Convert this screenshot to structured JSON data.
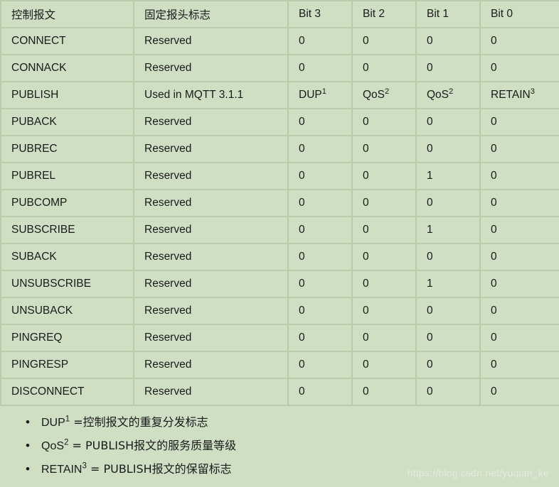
{
  "table": {
    "headers": [
      {
        "label": "控制报文",
        "type": "cn"
      },
      {
        "label": "固定报头标志",
        "type": "cn"
      },
      {
        "label": "Bit 3",
        "type": "bit"
      },
      {
        "label": "Bit 2",
        "type": "bit"
      },
      {
        "label": "Bit 1",
        "type": "bit"
      },
      {
        "label": "Bit 0",
        "type": "bit"
      }
    ],
    "rows": [
      {
        "message": "CONNECT",
        "flags": "Reserved",
        "bit3": "0",
        "bit2": "0",
        "bit1": "0",
        "bit0": "0"
      },
      {
        "message": "CONNACK",
        "flags": "Reserved",
        "bit3": "0",
        "bit2": "0",
        "bit1": "0",
        "bit0": "0"
      },
      {
        "message": "PUBLISH",
        "flags": "Used in MQTT 3.1.1",
        "bit3": "DUP",
        "bit3_sup": "1",
        "bit2": "QoS",
        "bit2_sup": "2",
        "bit1": "QoS",
        "bit1_sup": "2",
        "bit0": "RETAIN",
        "bit0_sup": "3"
      },
      {
        "message": "PUBACK",
        "flags": "Reserved",
        "bit3": "0",
        "bit2": "0",
        "bit1": "0",
        "bit0": "0"
      },
      {
        "message": "PUBREC",
        "flags": "Reserved",
        "bit3": "0",
        "bit2": "0",
        "bit1": "0",
        "bit0": "0"
      },
      {
        "message": "PUBREL",
        "flags": "Reserved",
        "bit3": "0",
        "bit2": "0",
        "bit1": "1",
        "bit0": "0"
      },
      {
        "message": "PUBCOMP",
        "flags": "Reserved",
        "bit3": "0",
        "bit2": "0",
        "bit1": "0",
        "bit0": "0"
      },
      {
        "message": "SUBSCRIBE",
        "flags": "Reserved",
        "bit3": "0",
        "bit2": "0",
        "bit1": "1",
        "bit0": "0"
      },
      {
        "message": "SUBACK",
        "flags": "Reserved",
        "bit3": "0",
        "bit2": "0",
        "bit1": "0",
        "bit0": "0"
      },
      {
        "message": "UNSUBSCRIBE",
        "flags": "Reserved",
        "bit3": "0",
        "bit2": "0",
        "bit1": "1",
        "bit0": "0"
      },
      {
        "message": "UNSUBACK",
        "flags": "Reserved",
        "bit3": "0",
        "bit2": "0",
        "bit1": "0",
        "bit0": "0"
      },
      {
        "message": "PINGREQ",
        "flags": "Reserved",
        "bit3": "0",
        "bit2": "0",
        "bit1": "0",
        "bit0": "0"
      },
      {
        "message": "PINGRESP",
        "flags": "Reserved",
        "bit3": "0",
        "bit2": "0",
        "bit1": "0",
        "bit0": "0"
      },
      {
        "message": "DISCONNECT",
        "flags": "Reserved",
        "bit3": "0",
        "bit2": "0",
        "bit1": "0",
        "bit0": "0"
      }
    ]
  },
  "notes": [
    {
      "term": "DUP",
      "sup": "1",
      "definition": " =控制报文的重复分发标志"
    },
    {
      "term": "QoS",
      "sup": "2",
      "definition": " = PUBLISH报文的服务质量等级"
    },
    {
      "term": "RETAIN",
      "sup": "3",
      "definition": " = PUBLISH报文的保留标志"
    }
  ],
  "watermark": "https://blog.csdn.net/yuqian_ke",
  "colors": {
    "background": "#cfdfc4",
    "grid": "#b9cbab",
    "text": "#1a1a1a",
    "watermark": "#e3ebdd"
  }
}
